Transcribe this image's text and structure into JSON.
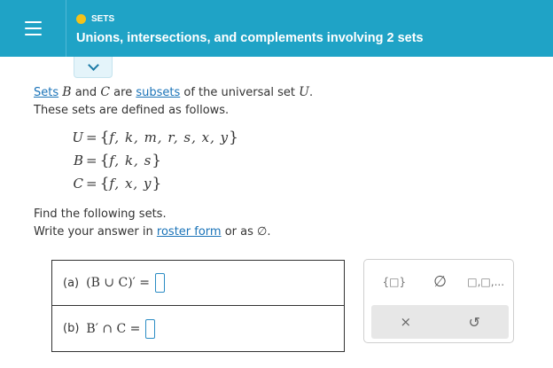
{
  "header": {
    "topic": "SETS",
    "title": "Unions, intersections, and complements involving 2 sets"
  },
  "problem": {
    "link_sets": "Sets",
    "set_b": "B",
    "and": "and",
    "set_c": "C",
    "are": "are",
    "link_subsets": "subsets",
    "of_universal": "of the universal set",
    "set_u": "U",
    "period": ".",
    "line2": "These sets are defined as follows."
  },
  "sets": [
    {
      "name": "U",
      "elements": "f, k, m, r, s, x, y"
    },
    {
      "name": "B",
      "elements": "f, k, s"
    },
    {
      "name": "C",
      "elements": "f, x, y"
    }
  ],
  "instructions": {
    "line1": "Find the following sets.",
    "line2_prefix": "Write your answer in",
    "link_roster": "roster form",
    "line2_suffix": "or as ∅."
  },
  "answers": [
    {
      "label": "(a)",
      "expression": "(B ∪ C)′ ="
    },
    {
      "label": "(b)",
      "expression": "B′ ∩ C ="
    }
  ],
  "toolbar": {
    "braces": "{□}",
    "empty_set": "∅",
    "list": "□,□,...",
    "clear": "×",
    "undo": "↺"
  }
}
